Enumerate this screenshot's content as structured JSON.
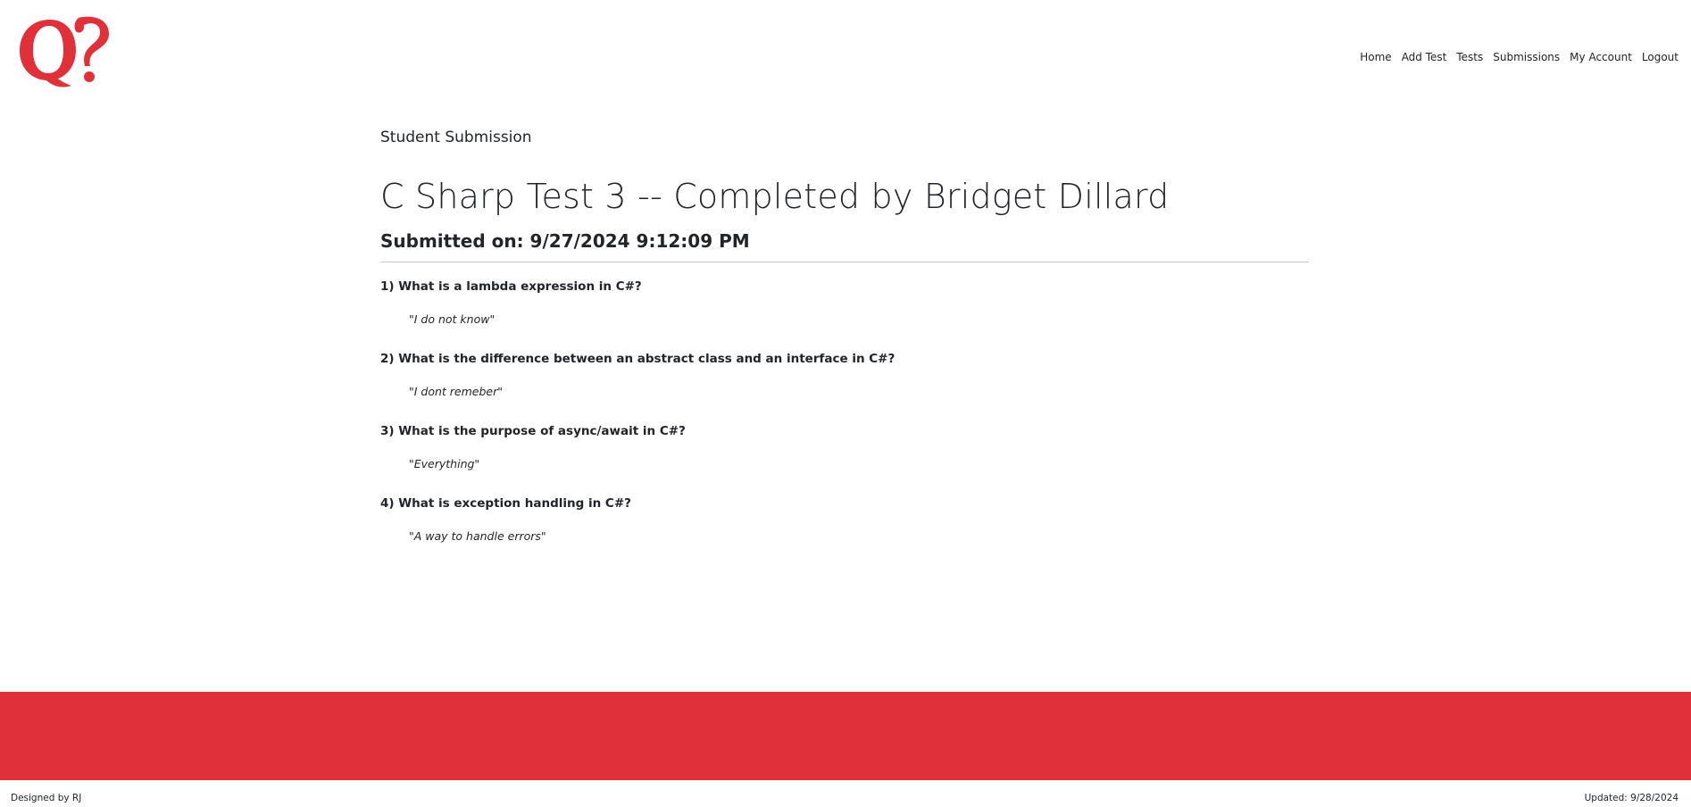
{
  "brand": {
    "color": "#e0313a"
  },
  "nav": {
    "items": [
      {
        "label": "Home"
      },
      {
        "label": "Add Test"
      },
      {
        "label": "Tests"
      },
      {
        "label": "Submissions"
      },
      {
        "label": "My Account"
      },
      {
        "label": "Logout"
      }
    ]
  },
  "page": {
    "section_label": "Student Submission",
    "title": "C Sharp Test 3 -- Completed by Bridget Dillard",
    "submitted": "Submitted on: 9/27/2024 9:12:09 PM"
  },
  "qa": [
    {
      "question": "1) What is a lambda expression in C#?",
      "answer": "\"I do not know\""
    },
    {
      "question": "2) What is the difference between an abstract class and an interface in C#?",
      "answer": "\"I dont remeber\""
    },
    {
      "question": "3) What is the purpose of async/await in C#?",
      "answer": "\"Everything\""
    },
    {
      "question": "4) What is exception handling in C#?",
      "answer": "\"A way to handle errors\""
    }
  ],
  "footer": {
    "left": "Designed by RJ",
    "right": "Updated: 9/28/2024"
  }
}
